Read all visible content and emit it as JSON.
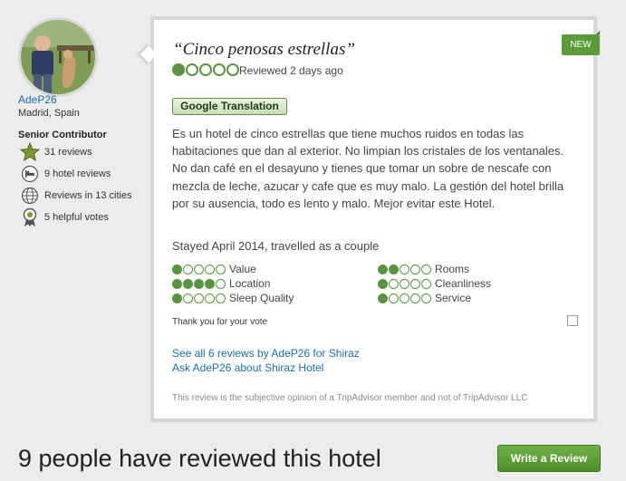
{
  "reviewer": {
    "username": "AdeP26",
    "location": "Madrid, Spain",
    "level": "Senior Contributor",
    "stats": [
      {
        "icon": "star-badge-icon",
        "text": "31 reviews"
      },
      {
        "icon": "hotel-bed-icon",
        "text": "9 hotel reviews"
      },
      {
        "icon": "globe-icon",
        "text": "Reviews in 13 cities"
      },
      {
        "icon": "helpful-ribbon-icon",
        "text": "5 helpful votes"
      }
    ]
  },
  "review": {
    "badge": "NEW",
    "title": "“Cinco penosas estrellas”",
    "overall_rating": 1,
    "rating_max": 5,
    "date": "Reviewed 2 days ago",
    "translate_button": "Google Translation",
    "body": "Es un hotel de cinco estrellas que tiene muchos ruidos en todas las habitaciones que dan al exterior. No limpian los cristales de los ventanales. No dan café en el desayuno y tienes que tomar un sobre de nescafe con mezcla de leche, azucar y cafe que es muy malo. La gestión del hotel brilla por su ausencia, todo es lento y malo. Mejor evitar este Hotel.",
    "stayed": "Stayed April 2014, travelled as a couple",
    "ratings": [
      {
        "label": "Value",
        "value": 1
      },
      {
        "label": "Rooms",
        "value": 2
      },
      {
        "label": "Location",
        "value": 4
      },
      {
        "label": "Cleanliness",
        "value": 1
      },
      {
        "label": "Sleep Quality",
        "value": 1
      },
      {
        "label": "Service",
        "value": 1
      }
    ],
    "vote_text": "Thank you for your vote",
    "see_all_link": "See all 6 reviews by AdeP26 for Shiraz",
    "ask_link": "Ask AdeP26 about Shiraz Hotel",
    "disclaimer": "This review is the subjective opinion of a TripAdvisor member and not of TripAdvisor LLC"
  },
  "footer": {
    "heading": "9 people have reviewed this hotel",
    "write_review_button": "Write a Review"
  },
  "colors": {
    "bubble_green": "#589442",
    "link_blue": "#1a6fa3",
    "button_green": "#4e8f2c"
  }
}
